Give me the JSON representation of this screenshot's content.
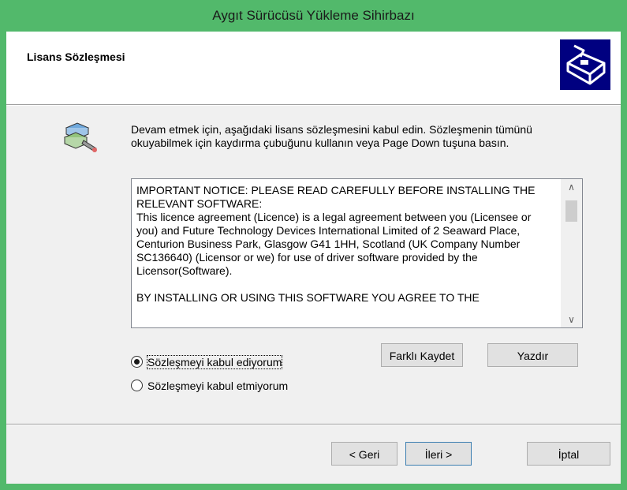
{
  "window": {
    "title": "Aygıt Sürücüsü Yükleme Sihirbazı"
  },
  "header": {
    "title": "Lisans Sözleşmesi",
    "logo_icon": "wizard-logo-icon"
  },
  "intro_text": "Devam etmek için, aşağıdaki lisans sözleşmesini kabul edin. Sözleşmenin tümünü okuyabilmek için kaydırma çubuğunu kullanın veya Page Down tuşuna basın.",
  "license": {
    "para1": "IMPORTANT NOTICE: PLEASE READ CAREFULLY BEFORE INSTALLING THE RELEVANT SOFTWARE:",
    "para2": "This licence agreement (Licence) is a legal agreement between you (Licensee or you) and Future Technology Devices International Limited of 2 Seaward Place, Centurion Business Park, Glasgow G41 1HH, Scotland (UK Company Number SC136640) (Licensor or we) for use of driver software provided by the Licensor(Software).",
    "para3": "BY INSTALLING OR USING THIS SOFTWARE YOU AGREE TO THE"
  },
  "buttons": {
    "save_as": "Farklı Kaydet",
    "print": "Yazdır",
    "back": "< Geri",
    "next": "İleri >",
    "cancel": "İptal"
  },
  "radios": {
    "accept": {
      "label": "Sözleşmeyi kabul ediyorum",
      "selected": true
    },
    "decline": {
      "label": "Sözleşmeyi kabul etmiyorum",
      "selected": false
    }
  }
}
